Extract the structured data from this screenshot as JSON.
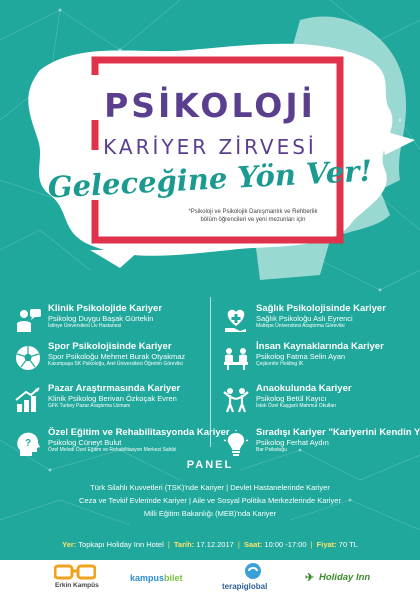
{
  "header": {
    "title_main": "PSİKOLOJİ",
    "title_sub": "KARİYER ZİRVESİ",
    "slogan": "Geleceğine Yön Ver!",
    "audience_line1": "*Psikoloji ve Psikolojik Danışmanlık ve Rehberlik",
    "audience_line2": "bölüm öğrencileri ve yeni mezunları için"
  },
  "topics_left": [
    {
      "title": "Klinik Psikolojide Kariyer",
      "speaker": "Psikolog Duygu Başak Gürtekin",
      "role": "İstinye Üniversitesi Liv Hastanesi",
      "icon": "counseling-icon"
    },
    {
      "title": "Spor Psikolojisinde Kariyer",
      "speaker": "Spor Psikoloğu Mehmet Burak Otyakmaz",
      "role": "Kasımpaşa SK Psikoloğu, Arel Üniversitesi Öğretim Görevlisi",
      "icon": "soccer-ball-icon"
    },
    {
      "title": "Pazar Araştırmasında Kariyer",
      "speaker": "Klinik Psikolog Berivan Özkoçak Evren",
      "role": "GFK Turkey Pazar Araştırma Uzmanı",
      "icon": "growth-chart-icon"
    },
    {
      "title": "Özel Eğitim ve Rehabilitasyonda Kariyer",
      "speaker": "Psikolog Cüneyt Bulut",
      "role": "Özel Melodi Özel Eğitim ve Rehabilitasyon Merkezi Sahibi",
      "icon": "head-question-icon"
    }
  ],
  "topics_right": [
    {
      "title": "Sağlık Psikolojisinde Kariyer",
      "speaker": "Sağlık Psikoloğu Aslı Eyrenci",
      "role": "Maltepe Üniversitesi Araştırma Görevlisi",
      "icon": "heart-hand-icon"
    },
    {
      "title": "İnsan Kaynaklarında Kariyer",
      "speaker": "Psikolog Fatma Selin Ayan",
      "role": "Çeşkonfor Holding İK",
      "icon": "meeting-icon"
    },
    {
      "title": "Anaokulunda Kariyer",
      "speaker": "Psikolog Betül Kayıcı",
      "role": "İstek Özel Kaşgarlı Mahmut Okulları",
      "icon": "children-icon"
    },
    {
      "title": "Sıradışı Kariyer \"Kariyerini Kendin Yarat\"",
      "speaker": "Psikolog Ferhat Aydın",
      "role": "Bar Psikoloğu",
      "icon": "lightbulb-icon"
    }
  ],
  "panel": {
    "title": "PANEL",
    "line1": "Türk Silahlı Kuvvetleri (TSK)'nde Kariyer | Devlet Hastanelerinde Kariyer",
    "line2": "Ceza ve Tevkif Evlerinde Kariyer | Aile ve Sosyal Politika Merkezlerinde Kariyer",
    "line3": "Milli Eğitim Bakanlığı (MEB)'nda Kariyer"
  },
  "info": {
    "place_label": "Yer:",
    "place": "Topkapı Holiday Inn Hotel",
    "date_label": "Tarih:",
    "date": "17.12.2017",
    "time_label": "Saat:",
    "time": "10:00 -17:00",
    "price_label": "Fiyat:",
    "price": "70 TL"
  },
  "sponsors": {
    "s1": "Erkin Kampüs",
    "s2": "kampus",
    "s2b": "bilet",
    "s3": "terapiglobal",
    "s4": "Holiday Inn"
  },
  "colors": {
    "background": "#1fa89b",
    "title": "#5b3f8f",
    "accent_red": "#e0324b",
    "slogan": "#1a9a90",
    "highlight": "#ffe36b"
  }
}
